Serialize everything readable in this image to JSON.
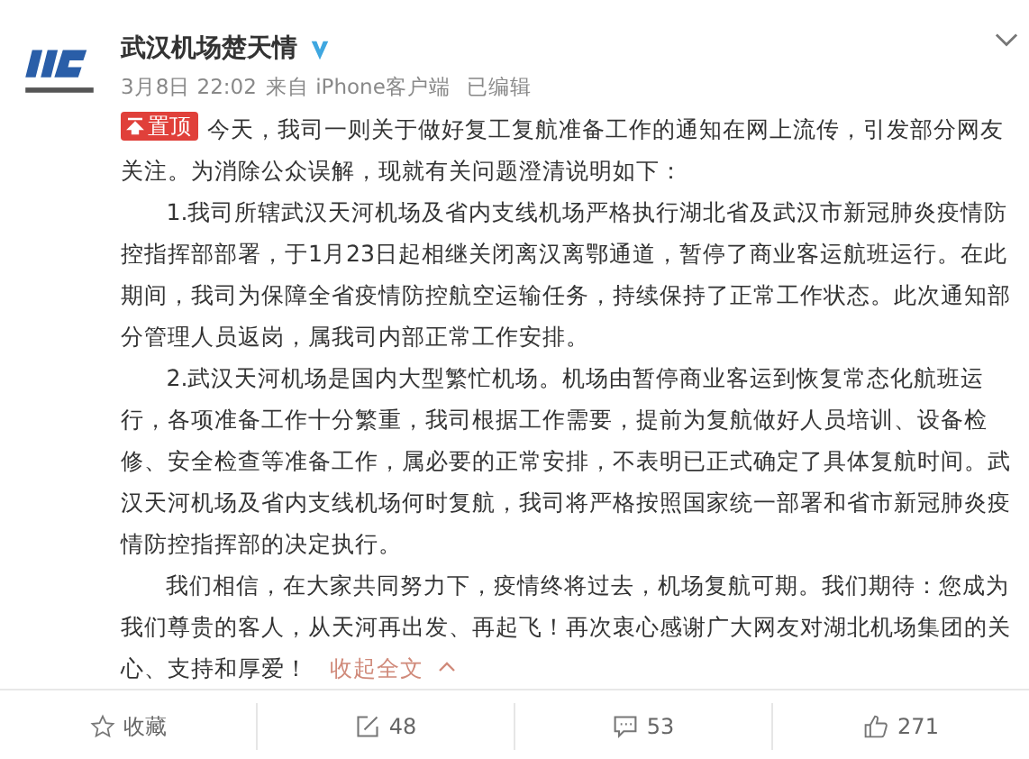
{
  "author": {
    "name": "武汉机场楚天情",
    "verified": true
  },
  "meta": {
    "date": "3月8日 22:02",
    "source": "来自 iPhone客户端",
    "edited": "已编辑"
  },
  "pinned_badge": "置顶",
  "paragraphs": [
    {
      "text": "今天，我司一则关于做好复工复航准备工作的通知在网上流传，引发部分网友关注。为消除公众误解，现就有关问题澄清说明如下："
    },
    {
      "text": "1.我司所辖武汉天河机场及省内支线机场严格执行湖北省及武汉市新冠肺炎疫情防控指挥部部署，于1月23日起相继关闭离汉离鄂通道，暂停了商业客运航班运行。在此期间，我司为保障全省疫情防控航空运输任务，持续保持了正常工作状态。此次通知部分管理人员返岗，属我司内部正常工作安排。"
    },
    {
      "text": "2.武汉天河机场是国内大型繁忙机场。机场由暂停商业客运到恢复常态化航班运行，各项准备工作十分繁重，我司根据工作需要，提前为复航做好人员培训、设备检修、安全检查等准备工作，属必要的正常安排，不表明已正式确定了具体复航时间。武汉天河机场及省内支线机场何时复航，我司将严格按照国家统一部署和省市新冠肺炎疫情防控指挥部的决定执行。"
    },
    {
      "text": "我们相信，在大家共同努力下，疫情终将过去，机场复航可期。我们期待：您成为我们尊贵的客人，从天河再出发、再起飞！再次衷心感谢广大网友对湖北机场集团的关心、支持和厚爱！"
    }
  ],
  "collapse_link": "收起全文",
  "actions": [
    {
      "kind": "favorite",
      "label": "收藏"
    },
    {
      "kind": "repost",
      "label": "48"
    },
    {
      "kind": "comment",
      "label": "53"
    },
    {
      "kind": "like",
      "label": "271"
    }
  ]
}
